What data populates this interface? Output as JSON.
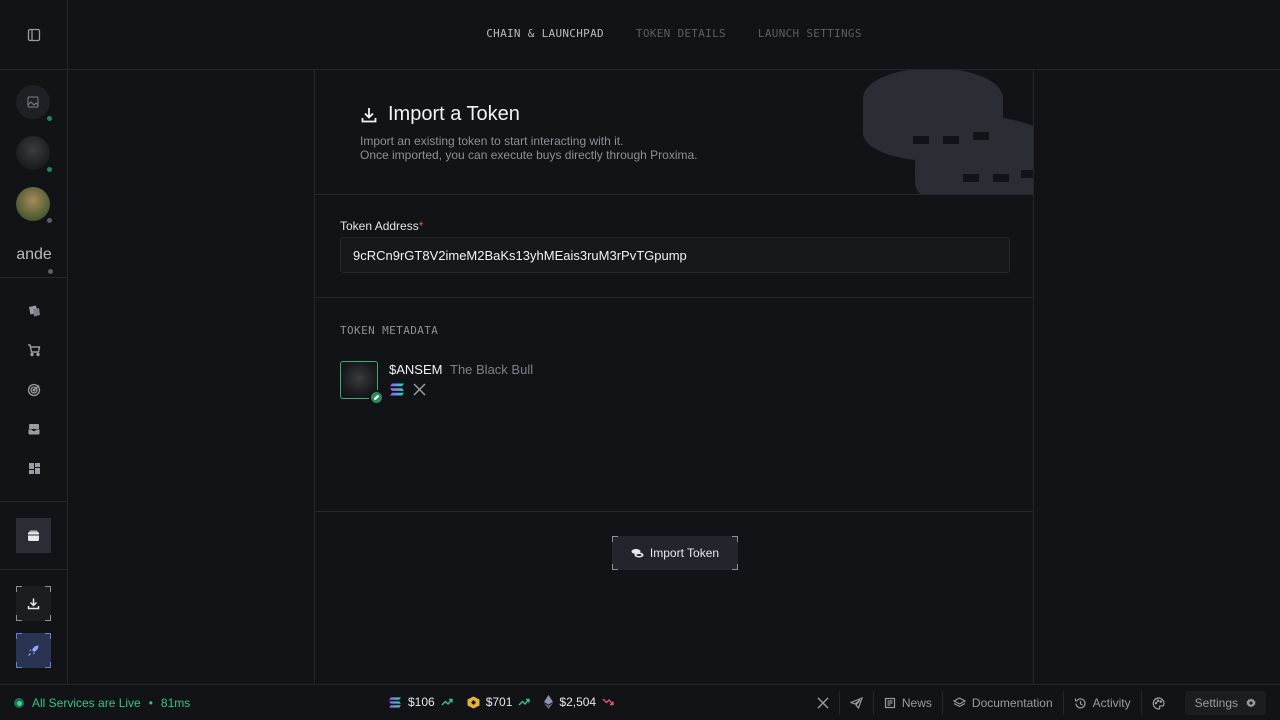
{
  "tabs": [
    {
      "label": "CHAIN & LAUNCHPAD",
      "active": true
    },
    {
      "label": "TOKEN DETAILS",
      "active": false
    },
    {
      "label": "LAUNCH SETTINGS",
      "active": false
    }
  ],
  "sidebar": {
    "wallet_label": "ande"
  },
  "header": {
    "title": "Import a Token",
    "desc_line1": "Import an existing token to start interacting with it.",
    "desc_line2": "Once imported, you can execute buys directly through Proxima."
  },
  "address": {
    "label": "Token Address",
    "required_mark": "*",
    "value": "9cRCn9rGT8V2imeM2BaKs13yhMEais3ruM3rPvTGpump"
  },
  "metadata": {
    "title": "TOKEN METADATA",
    "symbol": "$ANSEM",
    "name": "The Black Bull"
  },
  "import_button": {
    "label": "Import Token"
  },
  "footer": {
    "status": "All Services are Live",
    "latency": "81ms",
    "prices": [
      {
        "symbol_icon": "solana-icon",
        "value": "$106",
        "trend": "up"
      },
      {
        "symbol_icon": "bnb-icon",
        "value": "$701",
        "trend": "up"
      },
      {
        "symbol_icon": "ethereum-icon",
        "value": "$2,504",
        "trend": "down"
      }
    ],
    "links": {
      "news": "News",
      "docs": "Documentation",
      "activity": "Activity",
      "settings": "Settings"
    }
  },
  "colors": {
    "accent_green": "#37c28a",
    "trend_down": "#e0566a",
    "required": "#e0566a"
  }
}
